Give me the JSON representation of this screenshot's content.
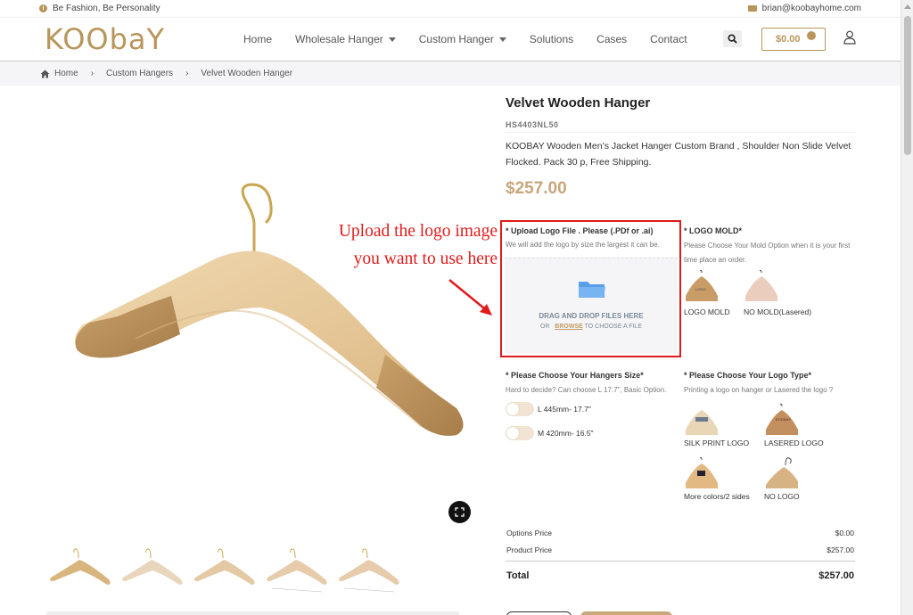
{
  "topbar": {
    "tagline": "Be Fashion, Be Personality",
    "email": "brian@koobayhome.com"
  },
  "header": {
    "logo": "KOObaY",
    "nav": [
      "Home",
      "Wholesale Hanger",
      "Custom Hanger",
      "Solutions",
      "Cases",
      "Contact"
    ],
    "cart_total": "$0.00"
  },
  "breadcrumb": [
    "Home",
    "Custom Hangers",
    "Velvet Wooden Hanger"
  ],
  "product": {
    "title": "Velvet Wooden Hanger",
    "sku": "HS4403NL50",
    "description": "KOOBAY Wooden Men’s Jacket Hanger Custom Brand , Shoulder Non Slide Velvet Flocked. Pack 30 p, Free Shipping.",
    "price": "$257.00"
  },
  "annotation": {
    "line1": "Upload the logo image",
    "line2": "you want to use here"
  },
  "upload": {
    "label": "* Upload Logo File . Please (.PDf or .ai)",
    "hint": "We will add the logo by size the largest it can be.",
    "drop_text": "DRAG AND DROP FILES HERE",
    "or_text": "OR",
    "browse_text": "BROWSE",
    "choose_text": "TO CHOOSE A FILE"
  },
  "logo_mold": {
    "label": "* LOGO MOLD*",
    "hint": "Please Choose Your Mold Option when it is your first time place an order.",
    "options": [
      "LOGO MOLD",
      "NO MOLD(Lasered)"
    ]
  },
  "hanger_size": {
    "label": "* Please Choose Your Hangers Size*",
    "hint": "Hard to decide? Can choose L 17.7\", Basic Option.",
    "options": [
      "L 445mm- 17.7\"",
      "M 420mm- 16.5\""
    ]
  },
  "logo_type": {
    "label": "* Please Choose Your Logo Type*",
    "hint": "Printing a logo on hanger or Lasered the logo ?",
    "options": [
      "SILK PRINT LOGO",
      "LASERED LOGO",
      "More colors/2 sides",
      "NO LOGO"
    ]
  },
  "totals": {
    "options_label": "Options Price",
    "options_value": "$0.00",
    "product_label": "Product Price",
    "product_value": "$257.00",
    "total_label": "Total",
    "total_value": "$257.00"
  },
  "colors": {
    "accent": "#b8955a",
    "price": "#c7a77b",
    "annotation_red": "#e01b1b"
  }
}
